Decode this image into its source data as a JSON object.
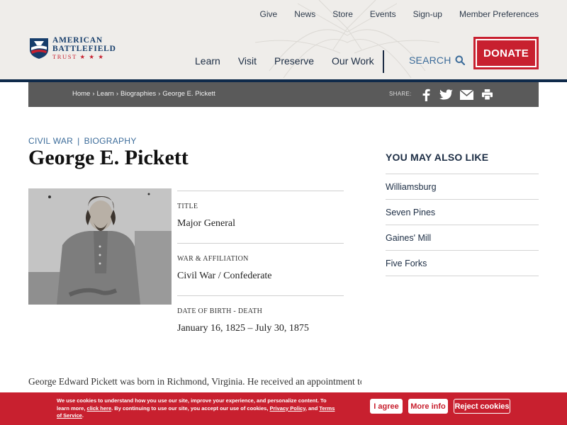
{
  "top_links": [
    "Give",
    "News",
    "Store",
    "Events",
    "Sign-up",
    "Member Preferences"
  ],
  "logo": {
    "line1": "AMERICAN",
    "line2": "BATTLEFIELD",
    "line3": "TRUST ★ ★ ★"
  },
  "main_nav": [
    "Learn",
    "Visit",
    "Preserve",
    "Our Work"
  ],
  "search_label": "SEARCH",
  "donate_label": "DONATE",
  "breadcrumb": [
    "Home",
    "Learn",
    "Biographies",
    "George E. Pickett"
  ],
  "share_label": "SHARE:",
  "share_icons": [
    "facebook-icon",
    "twitter-icon",
    "email-icon",
    "print-icon"
  ],
  "category": {
    "primary": "CIVIL WAR",
    "secondary": "BIOGRAPHY"
  },
  "title": "George E. Pickett",
  "facts": [
    {
      "label": "TITLE",
      "value": "Major General"
    },
    {
      "label": "WAR & AFFILIATION",
      "value": "Civil War / Confederate"
    },
    {
      "label": "DATE OF BIRTH - DEATH",
      "value": "January 16, 1825 – July 30, 1875"
    }
  ],
  "bio_snippet": "George Edward Pickett was born in Richmond, Virginia.  He received an appointment to",
  "sidebar": {
    "title": "YOU MAY ALSO LIKE",
    "items": [
      "Williamsburg",
      "Seven Pines",
      "Gaines' Mill",
      "Five Forks"
    ]
  },
  "cookie": {
    "text_a": "We use cookies to understand how you use our site, improve your experience, and personalize content. To learn more, ",
    "link_click": "click here",
    "text_b": ". By continuing to use our site, you accept our use of cookies, ",
    "link_privacy": "Privacy Policy",
    "text_c": ", and ",
    "link_terms": "Terms of Service",
    "text_d": ".",
    "agree": "I agree",
    "more": "More info",
    "reject": "Reject cookies"
  },
  "colors": {
    "brand_red": "#c8202f",
    "navy": "#0f2a4a",
    "link_blue": "#3c6c9a",
    "header_bg": "#efedea"
  }
}
